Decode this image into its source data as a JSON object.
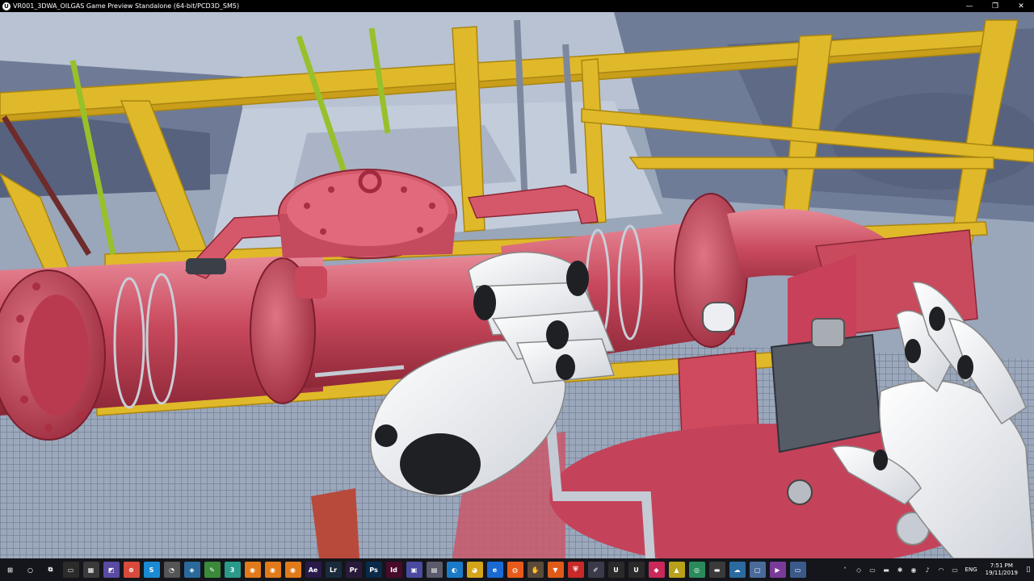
{
  "window": {
    "title": "VR001_3DWA_OILGAS Game Preview Standalone (64-bit/PCD3D_SM5)",
    "app_icon": "U",
    "minimize_glyph": "—",
    "maximize_glyph": "❐",
    "close_glyph": "✕"
  },
  "taskbar": {
    "apps": [
      {
        "name": "start-button",
        "glyph": "⊞",
        "bg": "#14161b"
      },
      {
        "name": "search-icon",
        "glyph": "○",
        "bg": "#14161b"
      },
      {
        "name": "task-view-icon",
        "glyph": "⧉",
        "bg": "#14161b"
      },
      {
        "name": "terminal-icon",
        "glyph": "▭",
        "bg": "#2b2b2b"
      },
      {
        "name": "calculator-icon",
        "glyph": "▦",
        "bg": "#3a3a3a"
      },
      {
        "name": "photos-icon",
        "glyph": "◩",
        "bg": "#5a4aa0"
      },
      {
        "name": "app-red-icon",
        "glyph": "⊗",
        "bg": "#d84a3a"
      },
      {
        "name": "skype-icon",
        "glyph": "S",
        "bg": "#1a8ad4"
      },
      {
        "name": "clock-app-icon",
        "glyph": "◔",
        "bg": "#555"
      },
      {
        "name": "network-icon",
        "glyph": "◈",
        "bg": "#2a6a9a"
      },
      {
        "name": "notepad-icon",
        "glyph": "✎",
        "bg": "#3a8a3a"
      },
      {
        "name": "3d-app-icon",
        "glyph": "3",
        "bg": "#2a9a8a"
      },
      {
        "name": "blender-icon",
        "glyph": "◉",
        "bg": "#e07a1a"
      },
      {
        "name": "blender-2-icon",
        "glyph": "◉",
        "bg": "#e07a1a"
      },
      {
        "name": "blender-3-icon",
        "glyph": "◉",
        "bg": "#e07a1a"
      },
      {
        "name": "ae-icon",
        "glyph": "Ae",
        "bg": "#2a1a4a"
      },
      {
        "name": "lightroom-icon",
        "glyph": "Lr",
        "bg": "#1a2a3a"
      },
      {
        "name": "premiere-icon",
        "glyph": "Pr",
        "bg": "#2a1a3a"
      },
      {
        "name": "photoshop-icon",
        "glyph": "Ps",
        "bg": "#0a2a4a"
      },
      {
        "name": "indesign-icon",
        "glyph": "Id",
        "bg": "#4a0a2a"
      },
      {
        "name": "monitor-icon",
        "glyph": "▣",
        "bg": "#4a4aa0"
      },
      {
        "name": "image-viewer-icon",
        "glyph": "▤",
        "bg": "#5a5a6a"
      },
      {
        "name": "edge-icon",
        "glyph": "◐",
        "bg": "#1a7ac8"
      },
      {
        "name": "chrome-icon",
        "glyph": "◕",
        "bg": "#d4a41a"
      },
      {
        "name": "ie-icon",
        "glyph": "e",
        "bg": "#1a6ad4"
      },
      {
        "name": "firefox-icon",
        "glyph": "◍",
        "bg": "#e85a1a"
      },
      {
        "name": "hand-app-icon",
        "glyph": "✋",
        "bg": "#5a4a3a"
      },
      {
        "name": "brave-icon",
        "glyph": "▼",
        "bg": "#e05a1a"
      },
      {
        "name": "shield-app-icon",
        "glyph": "⛨",
        "bg": "#c82a2a"
      },
      {
        "name": "brush-app-icon",
        "glyph": "✐",
        "bg": "#3a3a4a"
      },
      {
        "name": "unreal-icon",
        "glyph": "U",
        "bg": "#2a2a2a"
      },
      {
        "name": "unreal-2-icon",
        "glyph": "U",
        "bg": "#2a2a2a"
      },
      {
        "name": "eraser-app-icon",
        "glyph": "◆",
        "bg": "#c8285a"
      },
      {
        "name": "warning-app-icon",
        "glyph": "▲",
        "bg": "#b8a01a"
      },
      {
        "name": "globe-app-icon",
        "glyph": "◎",
        "bg": "#2a8a5a"
      },
      {
        "name": "folder-icon",
        "glyph": "▬",
        "bg": "#3a3a3a"
      },
      {
        "name": "cloud-app-icon",
        "glyph": "☁",
        "bg": "#2a6aa0"
      },
      {
        "name": "window-app-icon",
        "glyph": "▢",
        "bg": "#4a6a9a"
      },
      {
        "name": "media-app-icon",
        "glyph": "▶",
        "bg": "#7a3a9a"
      },
      {
        "name": "open-window-icon",
        "glyph": "▭",
        "bg": "#3a5a8a"
      }
    ],
    "systray": [
      {
        "name": "chevron-up-icon",
        "glyph": "˄"
      },
      {
        "name": "dropbox-icon",
        "glyph": "◇"
      },
      {
        "name": "monitor-tray-icon",
        "glyph": "▭"
      },
      {
        "name": "folder-tray-icon",
        "glyph": "▬"
      },
      {
        "name": "bluetooth-icon",
        "glyph": "✱"
      },
      {
        "name": "color-tray-icon",
        "glyph": "◉"
      },
      {
        "name": "speaker-icon",
        "glyph": "♪"
      },
      {
        "name": "wifi-icon",
        "glyph": "◠"
      },
      {
        "name": "battery-icon",
        "glyph": "▭"
      }
    ],
    "language": "ENG",
    "time": "7:51 PM",
    "date": "19/11/2019",
    "notification_glyph": "▯"
  }
}
